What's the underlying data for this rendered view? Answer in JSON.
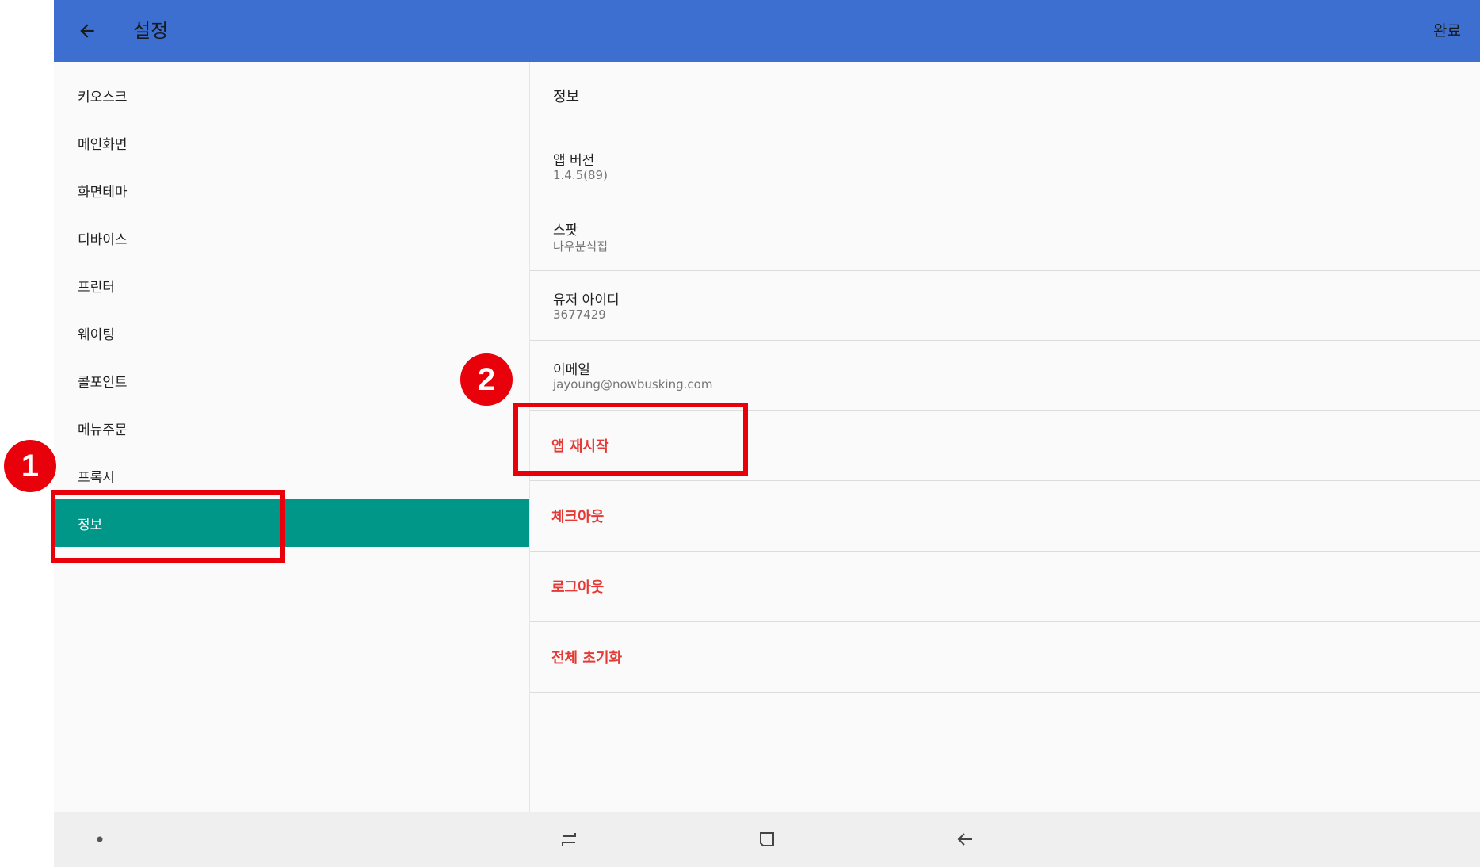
{
  "header": {
    "title": "설정",
    "done_label": "완료"
  },
  "sidebar": {
    "items": [
      {
        "label": "키오스크"
      },
      {
        "label": "메인화면"
      },
      {
        "label": "화면테마"
      },
      {
        "label": "디바이스"
      },
      {
        "label": "프린터"
      },
      {
        "label": "웨이팅"
      },
      {
        "label": "콜포인트"
      },
      {
        "label": "메뉴주문"
      },
      {
        "label": "프록시"
      },
      {
        "label": "정보",
        "selected": true
      }
    ]
  },
  "main": {
    "section_title": "정보",
    "info": [
      {
        "label": "앱 버전",
        "value": "1.4.5(89)"
      },
      {
        "label": "스팟",
        "value": "나우분식집"
      },
      {
        "label": "유저 아이디",
        "value": "3677429"
      },
      {
        "label": "이메일",
        "value": "jayoung@nowbusking.com"
      }
    ],
    "actions": [
      {
        "label": "앱 재시작"
      },
      {
        "label": "체크아웃"
      },
      {
        "label": "로그아웃"
      },
      {
        "label": "전체 초기화"
      }
    ]
  },
  "annotations": {
    "marker1": "1",
    "marker2": "2"
  },
  "colors": {
    "header_bg": "#3d6fd1",
    "selected_bg": "#009688",
    "action_text": "#e53935",
    "annotation": "#e8000b"
  },
  "icons": {
    "back": "arrow-left-icon",
    "nav_recents": "recents-icon",
    "nav_home": "home-square-icon",
    "nav_back": "back-arrow-icon"
  }
}
